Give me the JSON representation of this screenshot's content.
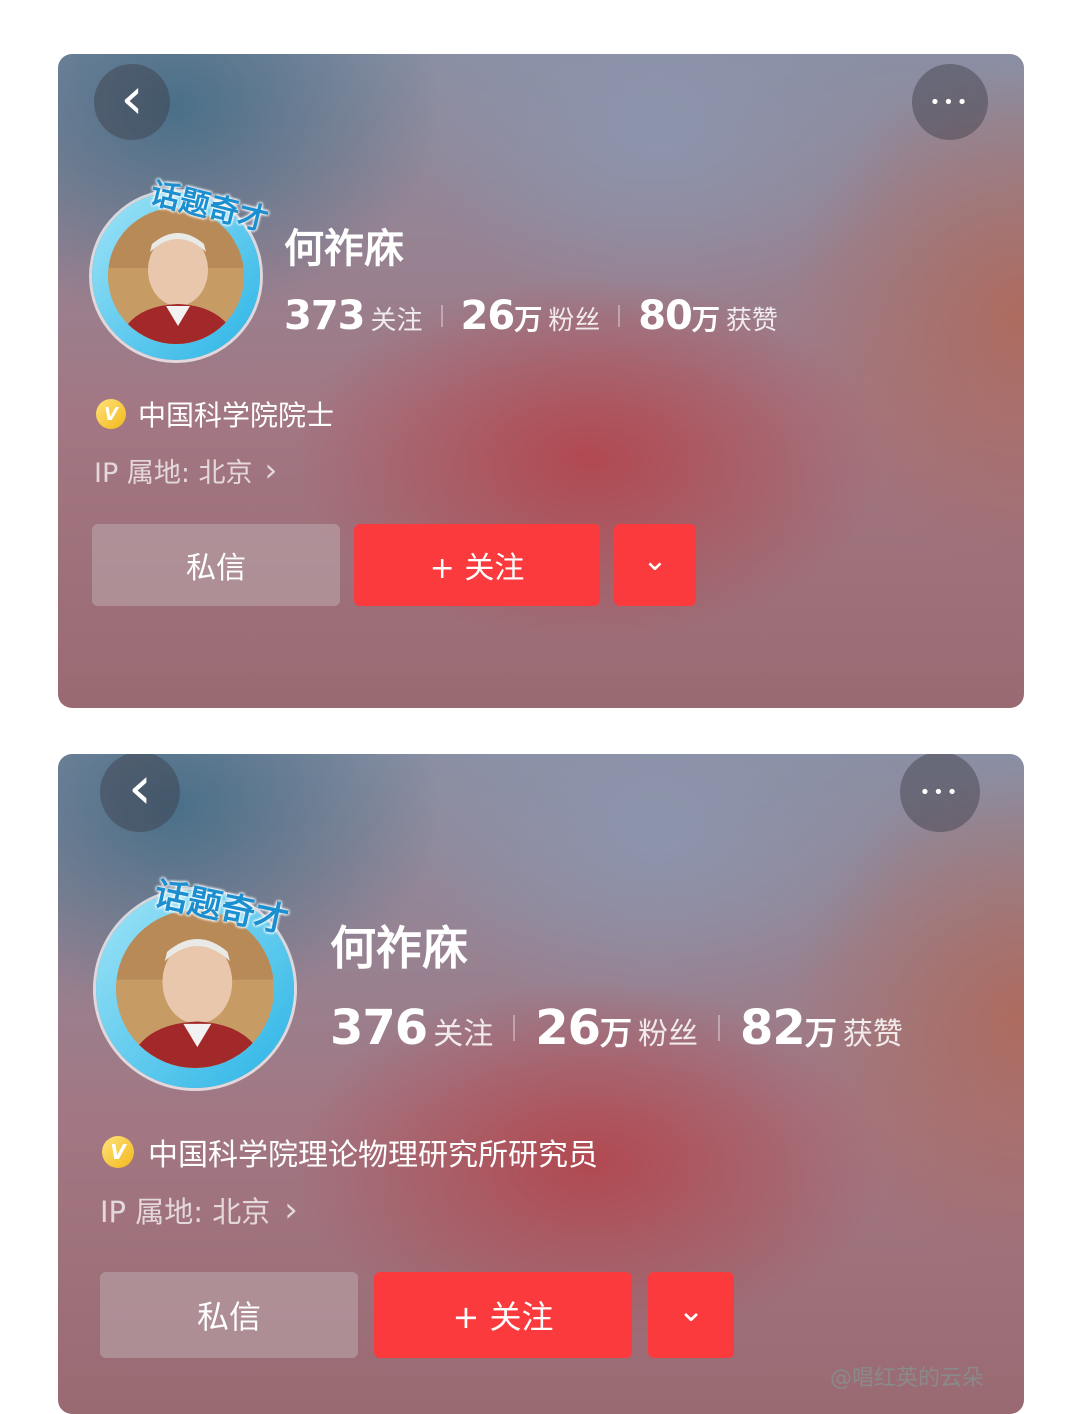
{
  "cards": [
    {
      "badge_text": "话题奇才",
      "username": "何祚庥",
      "stats": [
        {
          "num": "373",
          "unit": "",
          "label": "关注"
        },
        {
          "num": "26",
          "unit": "万",
          "label": "粉丝"
        },
        {
          "num": "80",
          "unit": "万",
          "label": "获赞"
        }
      ],
      "verify_icon": "V",
      "verification": "中国科学院院士",
      "ip_location": "IP 属地: 北京",
      "ip_chevron": "›",
      "back_icon": "‹",
      "more_icon": "•••",
      "message_button": "私信",
      "follow_button": "+ 关注",
      "dropdown_icon": "⌄"
    },
    {
      "badge_text": "话题奇才",
      "username": "何祚庥",
      "stats": [
        {
          "num": "376",
          "unit": "",
          "label": "关注"
        },
        {
          "num": "26",
          "unit": "万",
          "label": "粉丝"
        },
        {
          "num": "82",
          "unit": "万",
          "label": "获赞"
        }
      ],
      "verify_icon": "V",
      "verification": "中国科学院理论物理研究所研究员",
      "ip_location": "IP 属地: 北京",
      "ip_chevron": "›",
      "back_icon": "‹",
      "more_icon": "•••",
      "message_button": "私信",
      "follow_button": "+ 关注",
      "dropdown_icon": "⌄"
    }
  ],
  "watermark": "@唱红英的云朵",
  "colors": {
    "follow_red": "#fb3a3d",
    "badge_blue": "#2bb4e6",
    "verify_gold": "#f2b81b"
  }
}
